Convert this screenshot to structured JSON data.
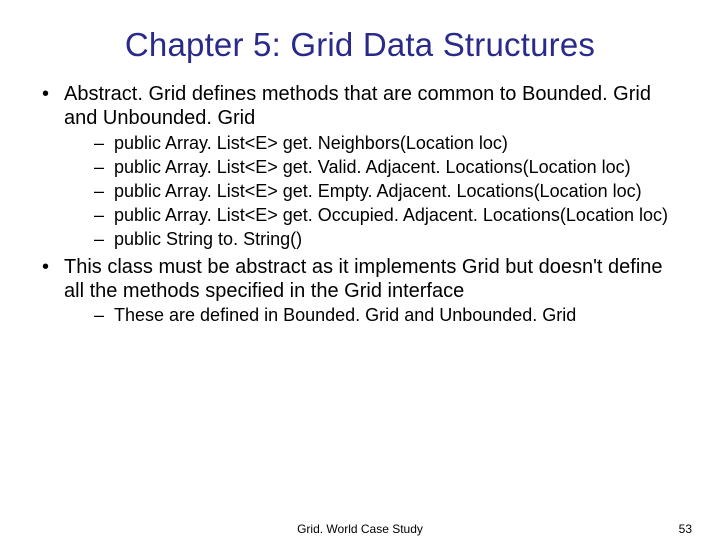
{
  "title": "Chapter 5: Grid Data Structures",
  "bullets": [
    {
      "text": "Abstract. Grid defines methods that are common to Bounded. Grid and Unbounded. Grid",
      "sub": [
        "public Array. List<E> get. Neighbors(Location loc)",
        "public Array. List<E> get. Valid. Adjacent. Locations(Location loc)",
        "public Array. List<E> get. Empty. Adjacent. Locations(Location loc)",
        "public Array. List<E> get. Occupied. Adjacent. Locations(Location loc)",
        "public String to. String()"
      ]
    },
    {
      "text": "This class must be abstract as it implements Grid but doesn't define all the methods specified in the Grid interface",
      "sub": [
        "These are defined in Bounded. Grid and Unbounded. Grid"
      ]
    }
  ],
  "footer": {
    "center": "Grid. World Case Study",
    "page": "53"
  }
}
